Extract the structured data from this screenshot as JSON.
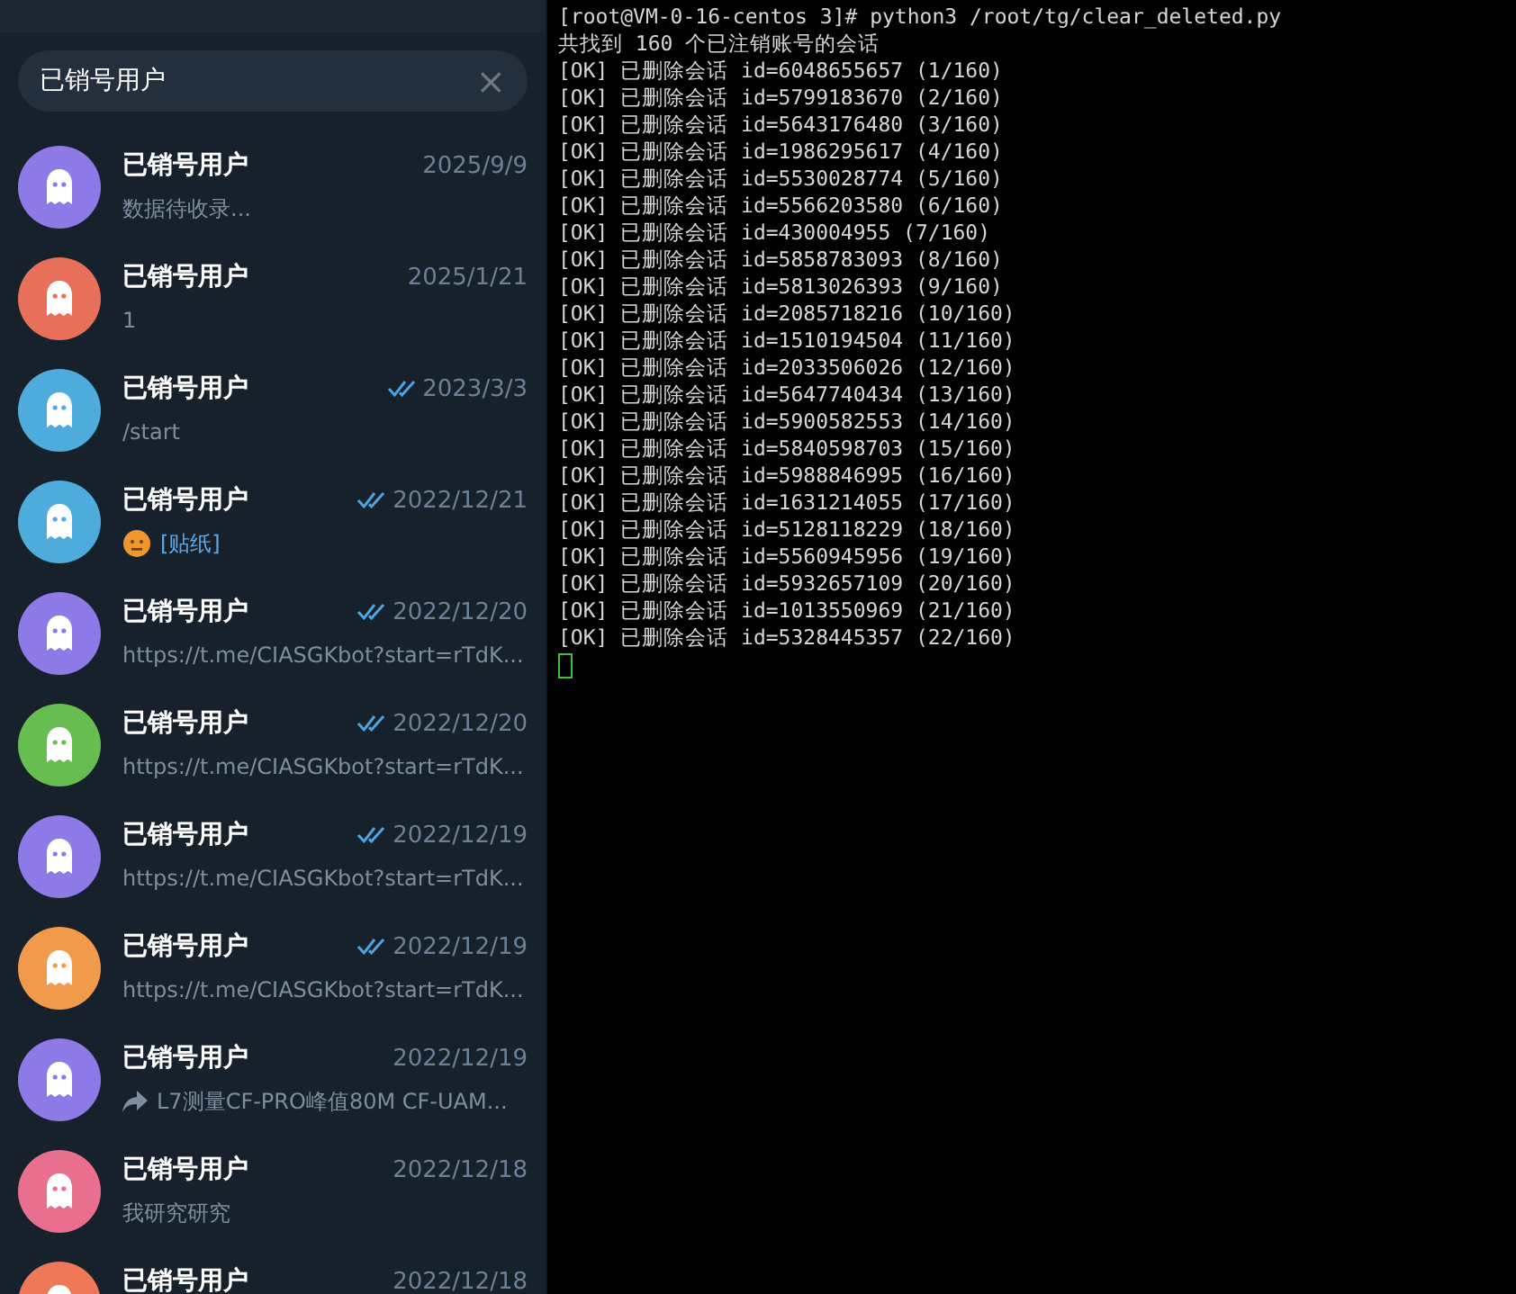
{
  "search": {
    "value": "已销号用户",
    "clear": "×"
  },
  "chats": [
    {
      "name": "已销号用户",
      "date": "2025/9/9",
      "read": false,
      "color": "#8d7ae6",
      "preview": {
        "kind": "text",
        "text": "数据待收录..."
      }
    },
    {
      "name": "已销号用户",
      "date": "2025/1/21",
      "read": false,
      "color": "#e8705a",
      "preview": {
        "kind": "text",
        "text": "1"
      }
    },
    {
      "name": "已销号用户",
      "date": "2023/3/3",
      "read": true,
      "color": "#4eacdc",
      "preview": {
        "kind": "text",
        "text": "/start"
      }
    },
    {
      "name": "已销号用户",
      "date": "2022/12/21",
      "read": true,
      "color": "#4eacdc",
      "preview": {
        "kind": "sticker",
        "text": "[贴纸]"
      }
    },
    {
      "name": "已销号用户",
      "date": "2022/12/20",
      "read": true,
      "color": "#8d7ae6",
      "preview": {
        "kind": "text",
        "text": "https://t.me/CIASGKbot?start=rTdK..."
      }
    },
    {
      "name": "已销号用户",
      "date": "2022/12/20",
      "read": true,
      "color": "#67bd50",
      "preview": {
        "kind": "text",
        "text": "https://t.me/CIASGKbot?start=rTdK..."
      }
    },
    {
      "name": "已销号用户",
      "date": "2022/12/19",
      "read": true,
      "color": "#8d7ae6",
      "preview": {
        "kind": "text",
        "text": "https://t.me/CIASGKbot?start=rTdK..."
      }
    },
    {
      "name": "已销号用户",
      "date": "2022/12/19",
      "read": true,
      "color": "#f29a4c",
      "preview": {
        "kind": "text",
        "text": "https://t.me/CIASGKbot?start=rTdK..."
      }
    },
    {
      "name": "已销号用户",
      "date": "2022/12/19",
      "read": false,
      "color": "#8d7ae6",
      "preview": {
        "kind": "forward",
        "text": "L7测量CF-PRO峰值80M CF-UAM..."
      }
    },
    {
      "name": "已销号用户",
      "date": "2022/12/18",
      "read": false,
      "color": "#e86f8e",
      "preview": {
        "kind": "text",
        "text": "我研究研究"
      }
    },
    {
      "name": "已销号用户",
      "date": "2022/12/18",
      "read": false,
      "color": "#ef7858"
    }
  ],
  "terminal": {
    "lines": [
      "[root@VM-0-16-centos 3]# python3 /root/tg/clear_deleted.py",
      "共找到 160 个已注销账号的会话",
      "[OK] 已删除会话 id=6048655657 (1/160)",
      "[OK] 已删除会话 id=5799183670 (2/160)",
      "[OK] 已删除会话 id=5643176480 (3/160)",
      "[OK] 已删除会话 id=1986295617 (4/160)",
      "[OK] 已删除会话 id=5530028774 (5/160)",
      "[OK] 已删除会话 id=5566203580 (6/160)",
      "[OK] 已删除会话 id=430004955 (7/160)",
      "[OK] 已删除会话 id=5858783093 (8/160)",
      "[OK] 已删除会话 id=5813026393 (9/160)",
      "[OK] 已删除会话 id=2085718216 (10/160)",
      "[OK] 已删除会话 id=1510194504 (11/160)",
      "[OK] 已删除会话 id=2033506026 (12/160)",
      "[OK] 已删除会话 id=5647740434 (13/160)",
      "[OK] 已删除会话 id=5900582553 (14/160)",
      "[OK] 已删除会话 id=5840598703 (15/160)",
      "[OK] 已删除会话 id=5988846995 (16/160)",
      "[OK] 已删除会话 id=1631214055 (17/160)",
      "[OK] 已删除会话 id=5128118229 (18/160)",
      "[OK] 已删除会话 id=5560945956 (19/160)",
      "[OK] 已删除会话 id=5932657109 (20/160)",
      "[OK] 已删除会话 id=1013550969 (21/160)",
      "[OK] 已删除会话 id=5328445357 (22/160)"
    ],
    "cursor": true
  }
}
